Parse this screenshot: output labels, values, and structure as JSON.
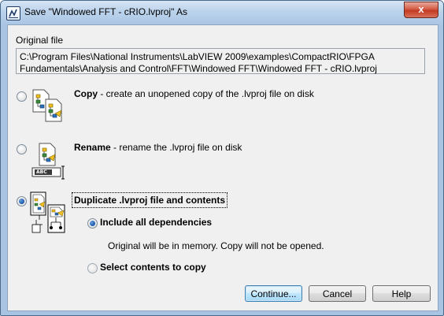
{
  "window": {
    "title": "Save \"Windowed FFT - cRIO.lvproj\" As",
    "close_glyph": "x"
  },
  "original_file": {
    "label": "Original file",
    "path_line1": "C:\\Program Files\\National Instruments\\LabVIEW 2009\\examples\\CompactRIO\\FPGA",
    "path_line2": "Fundamentals\\Analysis and Control\\FFT\\Windowed FFT\\Windowed FFT - cRIO.lvproj"
  },
  "options": {
    "copy": {
      "title": "Copy",
      "desc": " - create an unopened copy of the .lvproj file on disk",
      "selected": false,
      "icon": "copy-project-icon"
    },
    "rename": {
      "title": "Rename",
      "desc": " - rename the .lvproj file on disk",
      "selected": false,
      "icon": "rename-project-icon",
      "icon_caption": "ABC"
    },
    "duplicate": {
      "title": "Duplicate .lvproj file and contents",
      "selected": true,
      "icon": "duplicate-project-icon"
    }
  },
  "sub_options": {
    "include_all": {
      "label": "Include all dependencies",
      "selected": true
    },
    "info": "Original will be in memory. Copy will not be opened.",
    "select_contents": {
      "label": "Select contents to copy",
      "selected": false
    }
  },
  "buttons": {
    "continue": "Continue...",
    "cancel": "Cancel",
    "help": "Help"
  }
}
